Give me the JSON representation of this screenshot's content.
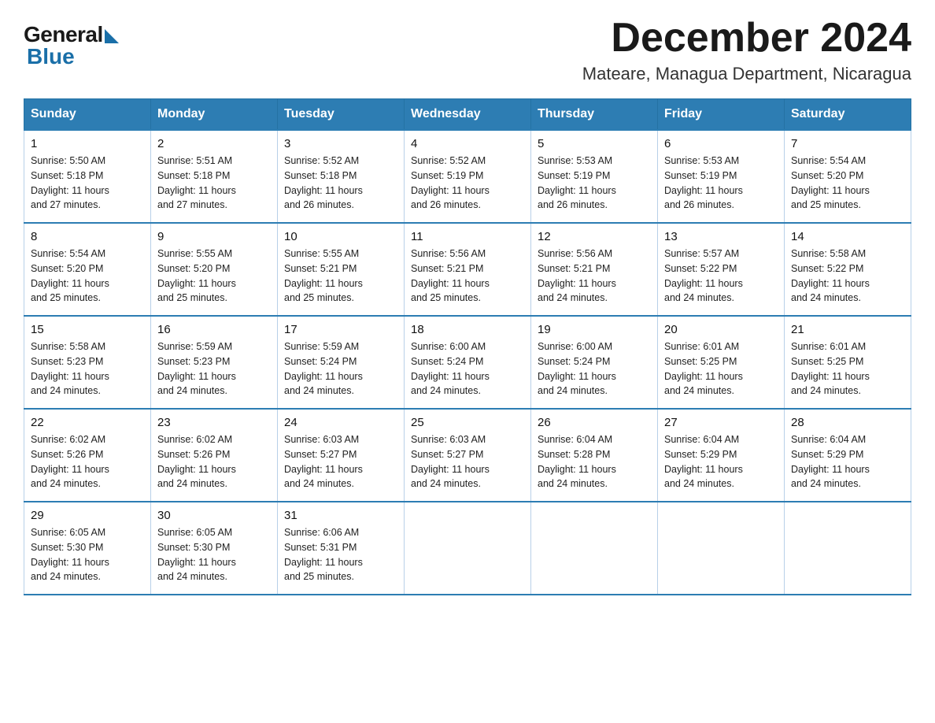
{
  "logo": {
    "general": "General",
    "blue": "Blue"
  },
  "header": {
    "title": "December 2024",
    "subtitle": "Mateare, Managua Department, Nicaragua"
  },
  "weekdays": [
    "Sunday",
    "Monday",
    "Tuesday",
    "Wednesday",
    "Thursday",
    "Friday",
    "Saturday"
  ],
  "weeks": [
    [
      {
        "day": "1",
        "sunrise": "5:50 AM",
        "sunset": "5:18 PM",
        "daylight": "11 hours and 27 minutes."
      },
      {
        "day": "2",
        "sunrise": "5:51 AM",
        "sunset": "5:18 PM",
        "daylight": "11 hours and 27 minutes."
      },
      {
        "day": "3",
        "sunrise": "5:52 AM",
        "sunset": "5:18 PM",
        "daylight": "11 hours and 26 minutes."
      },
      {
        "day": "4",
        "sunrise": "5:52 AM",
        "sunset": "5:19 PM",
        "daylight": "11 hours and 26 minutes."
      },
      {
        "day": "5",
        "sunrise": "5:53 AM",
        "sunset": "5:19 PM",
        "daylight": "11 hours and 26 minutes."
      },
      {
        "day": "6",
        "sunrise": "5:53 AM",
        "sunset": "5:19 PM",
        "daylight": "11 hours and 26 minutes."
      },
      {
        "day": "7",
        "sunrise": "5:54 AM",
        "sunset": "5:20 PM",
        "daylight": "11 hours and 25 minutes."
      }
    ],
    [
      {
        "day": "8",
        "sunrise": "5:54 AM",
        "sunset": "5:20 PM",
        "daylight": "11 hours and 25 minutes."
      },
      {
        "day": "9",
        "sunrise": "5:55 AM",
        "sunset": "5:20 PM",
        "daylight": "11 hours and 25 minutes."
      },
      {
        "day": "10",
        "sunrise": "5:55 AM",
        "sunset": "5:21 PM",
        "daylight": "11 hours and 25 minutes."
      },
      {
        "day": "11",
        "sunrise": "5:56 AM",
        "sunset": "5:21 PM",
        "daylight": "11 hours and 25 minutes."
      },
      {
        "day": "12",
        "sunrise": "5:56 AM",
        "sunset": "5:21 PM",
        "daylight": "11 hours and 24 minutes."
      },
      {
        "day": "13",
        "sunrise": "5:57 AM",
        "sunset": "5:22 PM",
        "daylight": "11 hours and 24 minutes."
      },
      {
        "day": "14",
        "sunrise": "5:58 AM",
        "sunset": "5:22 PM",
        "daylight": "11 hours and 24 minutes."
      }
    ],
    [
      {
        "day": "15",
        "sunrise": "5:58 AM",
        "sunset": "5:23 PM",
        "daylight": "11 hours and 24 minutes."
      },
      {
        "day": "16",
        "sunrise": "5:59 AM",
        "sunset": "5:23 PM",
        "daylight": "11 hours and 24 minutes."
      },
      {
        "day": "17",
        "sunrise": "5:59 AM",
        "sunset": "5:24 PM",
        "daylight": "11 hours and 24 minutes."
      },
      {
        "day": "18",
        "sunrise": "6:00 AM",
        "sunset": "5:24 PM",
        "daylight": "11 hours and 24 minutes."
      },
      {
        "day": "19",
        "sunrise": "6:00 AM",
        "sunset": "5:24 PM",
        "daylight": "11 hours and 24 minutes."
      },
      {
        "day": "20",
        "sunrise": "6:01 AM",
        "sunset": "5:25 PM",
        "daylight": "11 hours and 24 minutes."
      },
      {
        "day": "21",
        "sunrise": "6:01 AM",
        "sunset": "5:25 PM",
        "daylight": "11 hours and 24 minutes."
      }
    ],
    [
      {
        "day": "22",
        "sunrise": "6:02 AM",
        "sunset": "5:26 PM",
        "daylight": "11 hours and 24 minutes."
      },
      {
        "day": "23",
        "sunrise": "6:02 AM",
        "sunset": "5:26 PM",
        "daylight": "11 hours and 24 minutes."
      },
      {
        "day": "24",
        "sunrise": "6:03 AM",
        "sunset": "5:27 PM",
        "daylight": "11 hours and 24 minutes."
      },
      {
        "day": "25",
        "sunrise": "6:03 AM",
        "sunset": "5:27 PM",
        "daylight": "11 hours and 24 minutes."
      },
      {
        "day": "26",
        "sunrise": "6:04 AM",
        "sunset": "5:28 PM",
        "daylight": "11 hours and 24 minutes."
      },
      {
        "day": "27",
        "sunrise": "6:04 AM",
        "sunset": "5:29 PM",
        "daylight": "11 hours and 24 minutes."
      },
      {
        "day": "28",
        "sunrise": "6:04 AM",
        "sunset": "5:29 PM",
        "daylight": "11 hours and 24 minutes."
      }
    ],
    [
      {
        "day": "29",
        "sunrise": "6:05 AM",
        "sunset": "5:30 PM",
        "daylight": "11 hours and 24 minutes."
      },
      {
        "day": "30",
        "sunrise": "6:05 AM",
        "sunset": "5:30 PM",
        "daylight": "11 hours and 24 minutes."
      },
      {
        "day": "31",
        "sunrise": "6:06 AM",
        "sunset": "5:31 PM",
        "daylight": "11 hours and 25 minutes."
      },
      null,
      null,
      null,
      null
    ]
  ],
  "labels": {
    "sunrise": "Sunrise:",
    "sunset": "Sunset:",
    "daylight": "Daylight:"
  }
}
